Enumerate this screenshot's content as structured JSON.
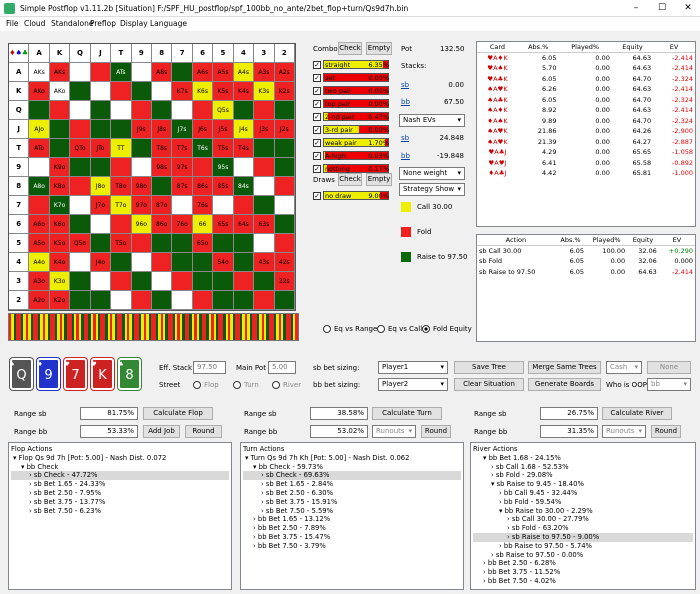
{
  "window": {
    "title": "Simple Postflop v1.11.2b [Situation] F:/SPF_HU_postflop/spf_100bb_no_ante/2bet_flop+turn/Qs9d7h.bin"
  },
  "menu": [
    "File",
    "Cloud",
    "Standalone",
    "Preflop",
    "Display",
    "Language"
  ],
  "grid": {
    "ranks": [
      "A",
      "K",
      "Q",
      "J",
      "T",
      "9",
      "8",
      "7",
      "6",
      "5",
      "4",
      "3",
      "2"
    ],
    "cells": [
      [
        "AKs",
        "",
        "",
        "ATs",
        "",
        "A8s",
        "",
        "A6s",
        "A5s",
        "A4s",
        "A3s",
        "A2s"
      ],
      [
        "AKo",
        "",
        "",
        "",
        "",
        "",
        "K7s",
        "K6s",
        "K5s",
        "K4s",
        "K3s",
        "K2s"
      ],
      [
        "",
        "",
        "",
        "",
        "",
        "",
        "",
        "",
        "Q5s",
        "",
        "",
        ""
      ],
      [
        "AJo",
        "",
        "",
        "",
        "",
        "J9s",
        "J8s",
        "J7s",
        "J6s",
        "J5s",
        "J4s",
        "J3s",
        "J2s"
      ],
      [
        "ATo",
        "",
        "QTo",
        "JTo",
        "TT",
        "",
        "T8s",
        "T7s",
        "T6s",
        "T5s",
        "T4s",
        "",
        ""
      ],
      [
        "",
        "K9o",
        "",
        "",
        "",
        "",
        "98s",
        "97s",
        "",
        "95s",
        "",
        "",
        ""
      ],
      [
        "A8o",
        "K8o",
        "",
        "J8o",
        "T8o",
        "98o",
        "",
        "87s",
        "86s",
        "85s",
        "84s",
        "",
        ""
      ],
      [
        "",
        "K7o",
        "",
        "J7o",
        "T7o",
        "97o",
        "87o",
        "",
        "76s",
        "",
        "",
        "",
        ""
      ],
      [
        "A6o",
        "K6o",
        "",
        "",
        "",
        "96o",
        "86o",
        "76o",
        "66",
        "65s",
        "64s",
        "63s",
        ""
      ],
      [
        "A5o",
        "K5o",
        "Q5o",
        "",
        "T5o",
        "",
        "",
        "",
        "65o",
        "",
        "",
        "",
        ""
      ],
      [
        "A4o",
        "K4o",
        "",
        "J4o",
        "",
        "",
        "",
        "",
        "",
        "54o",
        "",
        "43s",
        "42s"
      ],
      [
        "A3o",
        "K3o",
        "",
        "",
        "",
        "",
        "",
        "",
        "",
        "",
        "",
        "",
        "32s"
      ],
      [
        "A2o",
        "K2o",
        "",
        "",
        "",
        "",
        "",
        "",
        "",
        "",
        "",
        "",
        ""
      ]
    ]
  },
  "combos": {
    "title": "Combos",
    "check_label": "Check",
    "empty_label": "Empty",
    "items": [
      {
        "name": "straight",
        "pct": "6.35%",
        "fill": 0.92
      },
      {
        "name": "set",
        "pct": "0.00%",
        "fill": 0
      },
      {
        "name": "two pair",
        "pct": "0.00%",
        "fill": 0
      },
      {
        "name": "top pair",
        "pct": "0.00%",
        "fill": 0
      },
      {
        "name": "2-nd pair",
        "pct": "0.47%",
        "fill": 0.06
      },
      {
        "name": "3-rd pair",
        "pct": "0.00%",
        "fill": 0.55
      },
      {
        "name": "weak pair",
        "pct": "1.70%",
        "fill": 0.95
      },
      {
        "name": "A-high",
        "pct": "0.03%",
        "fill": 0.02
      },
      {
        "name": "nothing",
        "pct": "0.17%",
        "fill": 0.05
      }
    ]
  },
  "draws": {
    "title": "Draws",
    "check_label": "Check",
    "empty_label": "Empty",
    "items": [
      {
        "name": "no draw",
        "pct": "9.00%",
        "fill": 0.88
      }
    ]
  },
  "stacks": {
    "pot_label": "Pot",
    "pot_value": "132.50",
    "stacks_label": "Stacks:",
    "sb_label": "sb",
    "sb_value": "0.00",
    "bb_label": "bb",
    "bb_value": "67.50",
    "mode": "Nash EVs",
    "sb_ev": "24.848",
    "bb_ev": "-19.848",
    "weight": "None weight",
    "strategy": "Strategy Show"
  },
  "legend": [
    {
      "label": "Call 30.00",
      "color": "#eeee00"
    },
    {
      "label": "Fold",
      "color": "#ee2020"
    },
    {
      "label": "Raise to 97.50",
      "color": "#0a6a0a"
    }
  ],
  "hand_table": {
    "headers": [
      "Card",
      "Abs.%",
      "Played%",
      "Equity",
      "EV"
    ],
    "rows": [
      [
        "♥A♦K",
        "6.05",
        "0.00",
        "64.63",
        "-2.414"
      ],
      [
        "♥A♠K",
        "5.70",
        "0.00",
        "64.63",
        "-2.414"
      ],
      [
        "♥A♣K",
        "6.05",
        "0.00",
        "64.70",
        "-2.324"
      ],
      [
        "♠A♥K",
        "6.26",
        "0.00",
        "64.63",
        "-2.414"
      ],
      [
        "♠A♣K",
        "6.05",
        "0.00",
        "64.70",
        "-2.324"
      ],
      [
        "♠A♦K",
        "8.92",
        "0.00",
        "64.63",
        "-2.414"
      ],
      [
        "♦A♠K",
        "9.89",
        "0.00",
        "64.70",
        "-2.324"
      ],
      [
        "♠A♥K",
        "21.86",
        "0.00",
        "64.26",
        "-2.900"
      ],
      [
        "♠A♥K",
        "21.39",
        "0.00",
        "64.27",
        "-2.887"
      ],
      [
        "♥A♣J",
        "4.29",
        "0.00",
        "65.65",
        "-1.058"
      ],
      [
        "♥A♥J",
        "6.41",
        "0.00",
        "65.58",
        "-0.892"
      ],
      [
        "♦A♣J",
        "4.42",
        "0.00",
        "65.81",
        "-1.000"
      ]
    ]
  },
  "action_table": {
    "headers": [
      "Action",
      "Abs.%",
      "Played%",
      "Equity",
      "EV"
    ],
    "rows": [
      [
        "sb Call 30.00",
        "6.05",
        "100.00",
        "32.06",
        "+0.290"
      ],
      [
        "sb Fold",
        "6.05",
        "0.00",
        "32.06",
        "0.000"
      ],
      [
        "sb Raise to 97.50",
        "6.05",
        "0.00",
        "64.63",
        "-2.414"
      ]
    ]
  },
  "equity_radios": {
    "options": [
      "Eq vs Range",
      "Eq vs Call",
      "Fold Equity"
    ],
    "selected": 2
  },
  "board": [
    {
      "rank": "Q",
      "suit": "♠",
      "color": "#555"
    },
    {
      "rank": "9",
      "suit": "♦",
      "color": "#2233cc"
    },
    {
      "rank": "7",
      "suit": "♥",
      "color": "#cc2222"
    },
    {
      "rank": "K",
      "suit": "♥",
      "color": "#cc2222"
    },
    {
      "rank": "8",
      "suit": "♣",
      "color": "#338833"
    }
  ],
  "controls": {
    "eff_stack_label": "Eff. Stack",
    "eff_stack": "97.50",
    "main_pot_label": "Main Pot",
    "main_pot": "5.00",
    "street_label": "Street",
    "streets": [
      "Flop",
      "Turn",
      "River"
    ],
    "sb_sizing": "sb bet sizing:",
    "bb_sizing": "bb bet sizing:",
    "player1": "Player1",
    "player2": "Player2",
    "save_tree": "Save Tree",
    "clear_situation": "Clear Situation",
    "merge_trees": "Merge Same Trees",
    "generate_boards": "Generate Boards",
    "cash": "Cash",
    "none": "None",
    "who_oop": "Who is OOP:",
    "oop": "bb"
  },
  "flop": {
    "range_sb_label": "Range sb",
    "range_sb": "81.75%",
    "range_bb_label": "Range bb",
    "range_bb": "53.33%",
    "calc": "Calculate Flop",
    "add_job": "Add Job",
    "round": "Round",
    "tree_title": "Flop Actions",
    "tree": [
      [
        "▾ Flop Qs 9d 7h [Pot: 5.00] - Nash Dist. 0.072",
        0,
        0
      ],
      [
        "▾ bb Check",
        1,
        0
      ],
      [
        "› sb Check - 47.72%",
        2,
        1
      ],
      [
        "› sb Bet 1.65 - 24.33%",
        2,
        0
      ],
      [
        "› sb Bet 2.50 - 7.95%",
        2,
        0
      ],
      [
        "› sb Bet 3.75 - 13.77%",
        2,
        0
      ],
      [
        "› sb Bet 7.50 - 6.23%",
        2,
        0
      ]
    ]
  },
  "turn": {
    "range_sb_label": "Range sb",
    "range_sb": "38.58%",
    "range_bb_label": "Range bb",
    "range_bb": "53.02%",
    "calc": "Calculate Turn",
    "runouts": "Runouts",
    "round": "Round",
    "tree_title": "Turn Actions",
    "tree": [
      [
        "▾ Turn Qs 9d 7h Kh [Pot: 5.00] - Nash Dist. 0.062",
        0,
        0
      ],
      [
        "▾ bb Check - 59.73%",
        1,
        0
      ],
      [
        "› sb Check - 69.63%",
        2,
        1
      ],
      [
        "› sb Bet 1.65 - 2.84%",
        2,
        0
      ],
      [
        "› sb Bet 2.50 - 6.30%",
        2,
        0
      ],
      [
        "› sb Bet 3.75 - 15.91%",
        2,
        0
      ],
      [
        "› sb Bet 7.50 - 5.59%",
        2,
        0
      ],
      [
        "› bb Bet 1.65 - 13.12%",
        1,
        0
      ],
      [
        "› bb Bet 2.50 - 7.89%",
        1,
        0
      ],
      [
        "› bb Bet 3.75 - 15.47%",
        1,
        0
      ],
      [
        "› bb Bet 7.50 - 3.79%",
        1,
        0
      ]
    ]
  },
  "river": {
    "range_sb_label": "Range sb",
    "range_sb": "26.75%",
    "range_bb_label": "Range bb",
    "range_bb": "31.35%",
    "calc": "Calculate River",
    "runouts": "Runouts",
    "round": "Round",
    "tree_title": "River Actions",
    "tree": [
      [
        "▾ bb Bet 1.68 - 24.15%",
        1,
        0
      ],
      [
        "› sb Call 1.68 - 52.53%",
        2,
        0
      ],
      [
        "› sb Fold - 29.08%",
        2,
        0
      ],
      [
        "▾ sb Raise to 9.45 - 18.40%",
        2,
        0
      ],
      [
        "› bb Call 9.45 - 32.44%",
        3,
        0
      ],
      [
        "› bb Fold - 59.54%",
        3,
        0
      ],
      [
        "▾ bb Raise to 30.00 - 2.29%",
        3,
        0
      ],
      [
        "› sb Call 30.00 - 27.79%",
        4,
        0
      ],
      [
        "› sb Fold - 63.20%",
        4,
        0
      ],
      [
        "› sb Raise to 97.50 - 9.00%",
        4,
        1
      ],
      [
        "› bb Raise to 97.50 - 5.74%",
        3,
        0
      ],
      [
        "› sb Raise to 97.50 - 0.00%",
        2,
        0
      ],
      [
        "› bb Bet 2.50 - 6.28%",
        1,
        0
      ],
      [
        "› bb Bet 3.75 - 11.52%",
        1,
        0
      ],
      [
        "› bb Bet 7.50 - 4.02%",
        1,
        0
      ]
    ]
  }
}
